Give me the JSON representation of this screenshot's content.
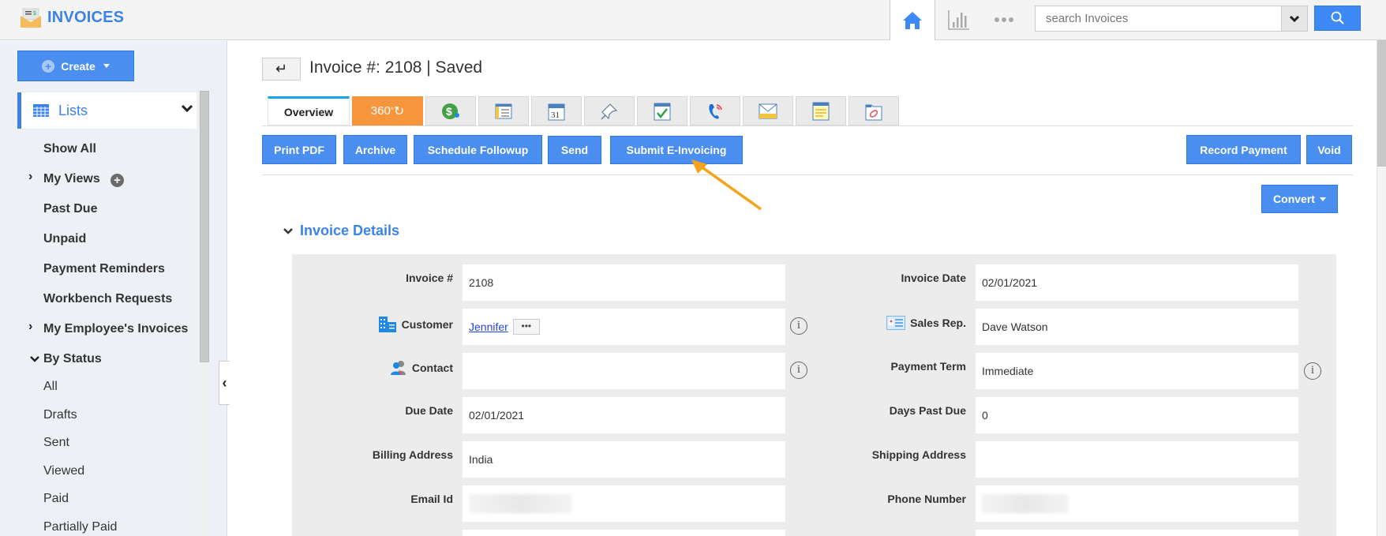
{
  "header": {
    "app_title": "INVOICES",
    "search_placeholder": "search Invoices",
    "icons": {
      "logo": "invoice-envelope-icon",
      "home": "home-icon",
      "reports": "bar-chart-icon",
      "more": "more-dots-icon",
      "dropdown": "chevron-down-icon",
      "search": "search-icon"
    }
  },
  "sidebar": {
    "create_label": "Create",
    "lists_label": "Lists",
    "items": [
      {
        "label": "Show All",
        "bold": true
      },
      {
        "label": "My Views",
        "bold": true,
        "expandable": true
      },
      {
        "label": "Past Due",
        "bold": true
      },
      {
        "label": "Unpaid",
        "bold": true
      },
      {
        "label": "Payment Reminders",
        "bold": true
      },
      {
        "label": "Workbench Requests",
        "bold": true
      },
      {
        "label": "My Employee's Invoices",
        "bold": true,
        "expandable": true
      },
      {
        "label": "By Status",
        "bold": true,
        "expanded": true
      }
    ],
    "status_items": [
      "All",
      "Drafts",
      "Sent",
      "Viewed",
      "Paid",
      "Partially Paid"
    ]
  },
  "main": {
    "title": "Invoice #: 2108 | Saved",
    "tabs": [
      {
        "label": "Overview",
        "active": true
      },
      {
        "label": "360",
        "icon": "360-view-icon"
      },
      {
        "icon": "dollar-icon"
      },
      {
        "icon": "form-list-icon"
      },
      {
        "icon": "calendar-icon",
        "text": "31"
      },
      {
        "icon": "pin-icon"
      },
      {
        "icon": "task-check-icon"
      },
      {
        "icon": "phone-call-icon"
      },
      {
        "icon": "email-icon"
      },
      {
        "icon": "notes-icon"
      },
      {
        "icon": "attachment-icon"
      }
    ],
    "actions": {
      "print_pdf": "Print PDF",
      "archive": "Archive",
      "schedule_followup": "Schedule Followup",
      "send": "Send",
      "submit_einvoicing": "Submit E-Invoicing",
      "record_payment": "Record Payment",
      "void": "Void",
      "convert": "Convert"
    },
    "section_title": "Invoice Details",
    "fields_left": [
      {
        "label": "Invoice #",
        "value": "2108"
      },
      {
        "label": "Customer",
        "value": "Jennifer",
        "link": true,
        "icon": "customer-building-icon",
        "info": true
      },
      {
        "label": "Contact",
        "value": "",
        "icon": "contact-people-icon",
        "info": true
      },
      {
        "label": "Due Date",
        "value": "02/01/2021"
      },
      {
        "label": "Billing Address",
        "value": "India"
      },
      {
        "label": "Email Id",
        "value": "",
        "redacted": true
      }
    ],
    "fields_right": [
      {
        "label": "Invoice Date",
        "value": "02/01/2021"
      },
      {
        "label": "Sales Rep.",
        "value": "Dave Watson",
        "icon": "sales-rep-card-icon"
      },
      {
        "label": "Payment Term",
        "value": "Immediate",
        "info": true
      },
      {
        "label": "Days Past Due",
        "value": "0"
      },
      {
        "label": "Shipping Address",
        "value": ""
      },
      {
        "label": "Phone Number",
        "value": "",
        "redacted": true
      }
    ]
  },
  "colors": {
    "brand_blue": "#3b82e6",
    "button_blue": "#4a8ef0",
    "tab_360_orange": "#f7953d",
    "annotation_arrow": "#f7a21b"
  }
}
